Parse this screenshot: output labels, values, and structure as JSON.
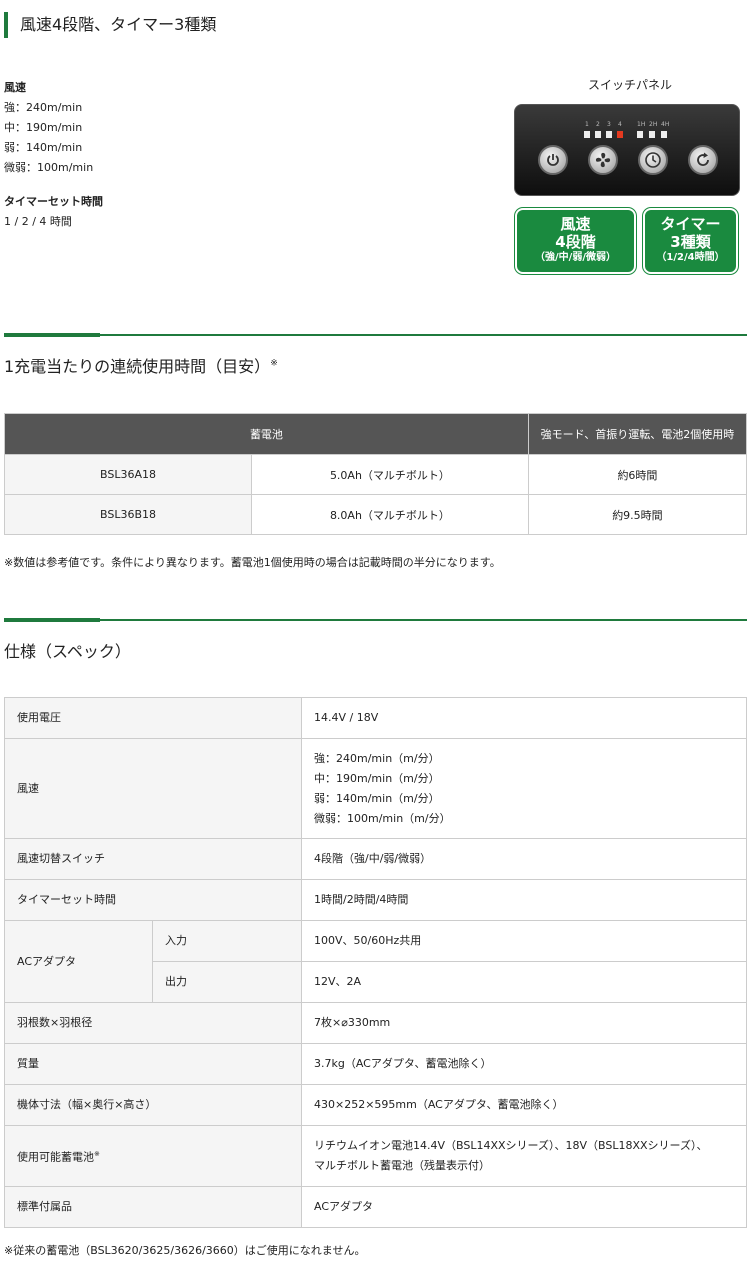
{
  "section1": {
    "heading": "風速4段階、タイマー3種類",
    "wind_label": "風速",
    "wind_lines": [
      "強：240m/min",
      "中：190m/min",
      "弱：140m/min",
      "微弱：100m/min"
    ],
    "timer_label": "タイマーセット時間",
    "timer_value": "1 / 2 / 4 時間",
    "panel": {
      "caption": "スイッチパネル",
      "speed_indicator_labels": [
        "1",
        "2",
        "3",
        "4"
      ],
      "timer_indicator_labels": [
        "1H",
        "2H",
        "4H"
      ],
      "active_speed_level": 4,
      "buttons": [
        "power-icon",
        "fan-icon",
        "clock-icon",
        "swing-icon"
      ],
      "box_wind": {
        "line1": "風速",
        "line2": "4段階",
        "line3": "（強/中/弱/微弱）"
      },
      "box_timer": {
        "line1": "タイマー",
        "line2": "3種類",
        "line3": "（1/2/4時間）"
      },
      "accent_color": "#1a8a3f"
    }
  },
  "section2": {
    "title": "1充電当たりの連続使用時間（目安）",
    "title_mark": "※",
    "table": {
      "headers": [
        "蓄電池",
        "強モード、首振り運転、電池2個使用時"
      ],
      "rows": [
        [
          "BSL36A18",
          "5.0Ah（マルチボルト）",
          "約6時間"
        ],
        [
          "BSL36B18",
          "8.0Ah（マルチボルト）",
          "約9.5時間"
        ]
      ]
    },
    "note": "※数値は参考値です。条件により異なります。蓄電池1個使用時の場合は記載時間の半分になります。"
  },
  "section3": {
    "title": "仕様（スペック）",
    "rows": {
      "voltage": {
        "key": "使用電圧",
        "value": "14.4V / 18V"
      },
      "wind": {
        "key": "風速",
        "values": [
          "強：240m/min（m/分）",
          "中：190m/min（m/分）",
          "弱：140m/min（m/分）",
          "微弱：100m/min（m/分）"
        ]
      },
      "switch": {
        "key": "風速切替スイッチ",
        "value": "4段階（強/中/弱/微弱）"
      },
      "timer": {
        "key": "タイマーセット時間",
        "value": "1時間/2時間/4時間"
      },
      "adapter": {
        "key": "ACアダプタ",
        "in_key": "入力",
        "in_value": "100V、50/60Hz共用",
        "out_key": "出力",
        "out_value": "12V、2A"
      },
      "blades": {
        "key": "羽根数×羽根径",
        "value": "7枚×⌀330mm"
      },
      "mass": {
        "key": "質量",
        "value": "3.7kg（ACアダプタ、蓄電池除く）"
      },
      "dims": {
        "key": "機体寸法（幅×奥行×高さ）",
        "value": "430×252×595mm（ACアダプタ、蓄電池除く）"
      },
      "batteries": {
        "key": "使用可能蓄電池",
        "key_mark": "※",
        "values": [
          "リチウムイオン電池14.4V（BSL14XXシリーズ）、18V（BSL18XXシリーズ）、",
          "マルチボルト蓄電池（残量表示付）"
        ]
      },
      "accessory": {
        "key": "標準付属品",
        "value": "ACアダプタ"
      }
    },
    "note": "※従来の蓄電池（BSL3620/3625/3626/3660）はご使用になれません。"
  }
}
